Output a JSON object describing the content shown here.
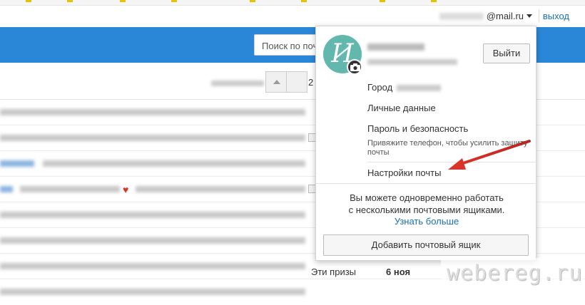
{
  "header": {
    "account_domain": "@mail.ru",
    "logout_label": "выход",
    "search_placeholder": "Поиск по почте"
  },
  "toolbar": {
    "page_number": "2"
  },
  "mail_list": {
    "last_row_subject": "Эти призы",
    "last_row_date": "6 ноя"
  },
  "dropdown": {
    "avatar_letter": "И",
    "exit_label": "Выйти",
    "city_label": "Город",
    "personal_data_label": "Личные данные",
    "password_security_label": "Пароль и безопасность",
    "password_hint": "Привяжите телефон, чтобы усилить защиту почты",
    "mail_settings_label": "Настройки почты",
    "multi_mailbox_text_line1": "Вы можете одновременно работать",
    "multi_mailbox_text_line2": "с несколькими почтовыми ящиками.",
    "learn_more_label": "Узнать больше",
    "add_mailbox_label": "Добавить почтовый ящик"
  },
  "watermark": {
    "text": "webereg.ru"
  },
  "colors": {
    "header_blue": "#2a87d8",
    "avatar_teal": "#63b8ae",
    "link_blue": "#1a6fb4",
    "annotation_red": "#d9342b"
  }
}
